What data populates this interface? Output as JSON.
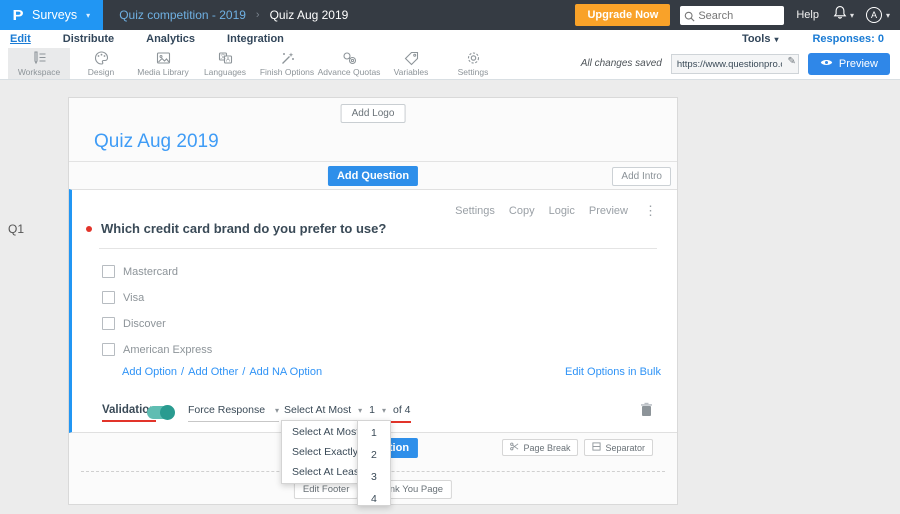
{
  "topbar": {
    "product_label": "Surveys",
    "breadcrumb_parent": "Quiz competition - 2019",
    "breadcrumb_current": "Quiz Aug 2019",
    "upgrade_label": "Upgrade Now",
    "search_placeholder": "Search",
    "help_label": "Help",
    "avatar_initial": "A"
  },
  "nav": {
    "items": [
      {
        "label": "Edit"
      },
      {
        "label": "Distribute"
      },
      {
        "label": "Analytics"
      },
      {
        "label": "Integration"
      }
    ],
    "tools_label": "Tools",
    "responses_label": "Responses: 0"
  },
  "toolbar": {
    "items": [
      {
        "label": "Workspace",
        "icon": "workspace-icon",
        "active": true
      },
      {
        "label": "Design",
        "icon": "design-icon"
      },
      {
        "label": "Media Library",
        "icon": "media-library-icon"
      },
      {
        "label": "Languages",
        "icon": "languages-icon"
      },
      {
        "label": "Finish Options",
        "icon": "finish-options-icon"
      },
      {
        "label": "Advance Quotas",
        "icon": "advance-quotas-icon"
      },
      {
        "label": "Variables",
        "icon": "variables-icon"
      },
      {
        "label": "Settings",
        "icon": "settings-icon"
      }
    ],
    "saved_status": "All changes saved",
    "survey_url": "https://www.questionpro.com/t/APNrFZ",
    "preview_label": "Preview"
  },
  "survey": {
    "add_logo_label": "Add Logo",
    "title": "Quiz Aug 2019",
    "add_question_label": "Add Question",
    "add_intro_label": "Add Intro",
    "question": {
      "id_label": "Q1",
      "menu": [
        {
          "label": "Settings"
        },
        {
          "label": "Copy"
        },
        {
          "label": "Logic"
        },
        {
          "label": "Preview"
        }
      ],
      "text": "Which credit card brand do you prefer to use?",
      "options": [
        {
          "label": "Mastercard"
        },
        {
          "label": "Visa"
        },
        {
          "label": "Discover"
        },
        {
          "label": "American Express"
        }
      ],
      "add_links": [
        {
          "label": "Add Option"
        },
        {
          "label": "Add Other"
        },
        {
          "label": "Add NA Option"
        }
      ],
      "links_separator": "/",
      "bulk_edit_label": "Edit Options in Bulk",
      "validation": {
        "label": "Validation",
        "toggle_state": "on",
        "force_response_label": "Force Response",
        "rule_value": "Select At Most",
        "count_value": "1",
        "of_label": "of 4"
      }
    },
    "page_break_label": "Page Break",
    "separator_label": "Separator",
    "edit_footer_label": "Edit Footer",
    "thank_you_label": "Thank You Page"
  },
  "dropdowns": {
    "rule_options": [
      {
        "label": "Select At Most"
      },
      {
        "label": "Select Exactly"
      },
      {
        "label": "Select At Least"
      }
    ],
    "count_options": [
      {
        "label": "1"
      },
      {
        "label": "2"
      },
      {
        "label": "3"
      },
      {
        "label": "4"
      }
    ]
  },
  "icons": {
    "logo": "P",
    "caret": "▾",
    "breadcrumb_sep": "›",
    "ellipsis": "⋮",
    "pencil": "✎"
  },
  "colors": {
    "accent_blue": "#2196f3",
    "link_blue": "#2f93f6",
    "upgrade_orange": "#f9a229",
    "toggle_teal": "#2a9b90",
    "required_red": "#e2342a",
    "topbar_dark": "#353b43"
  }
}
